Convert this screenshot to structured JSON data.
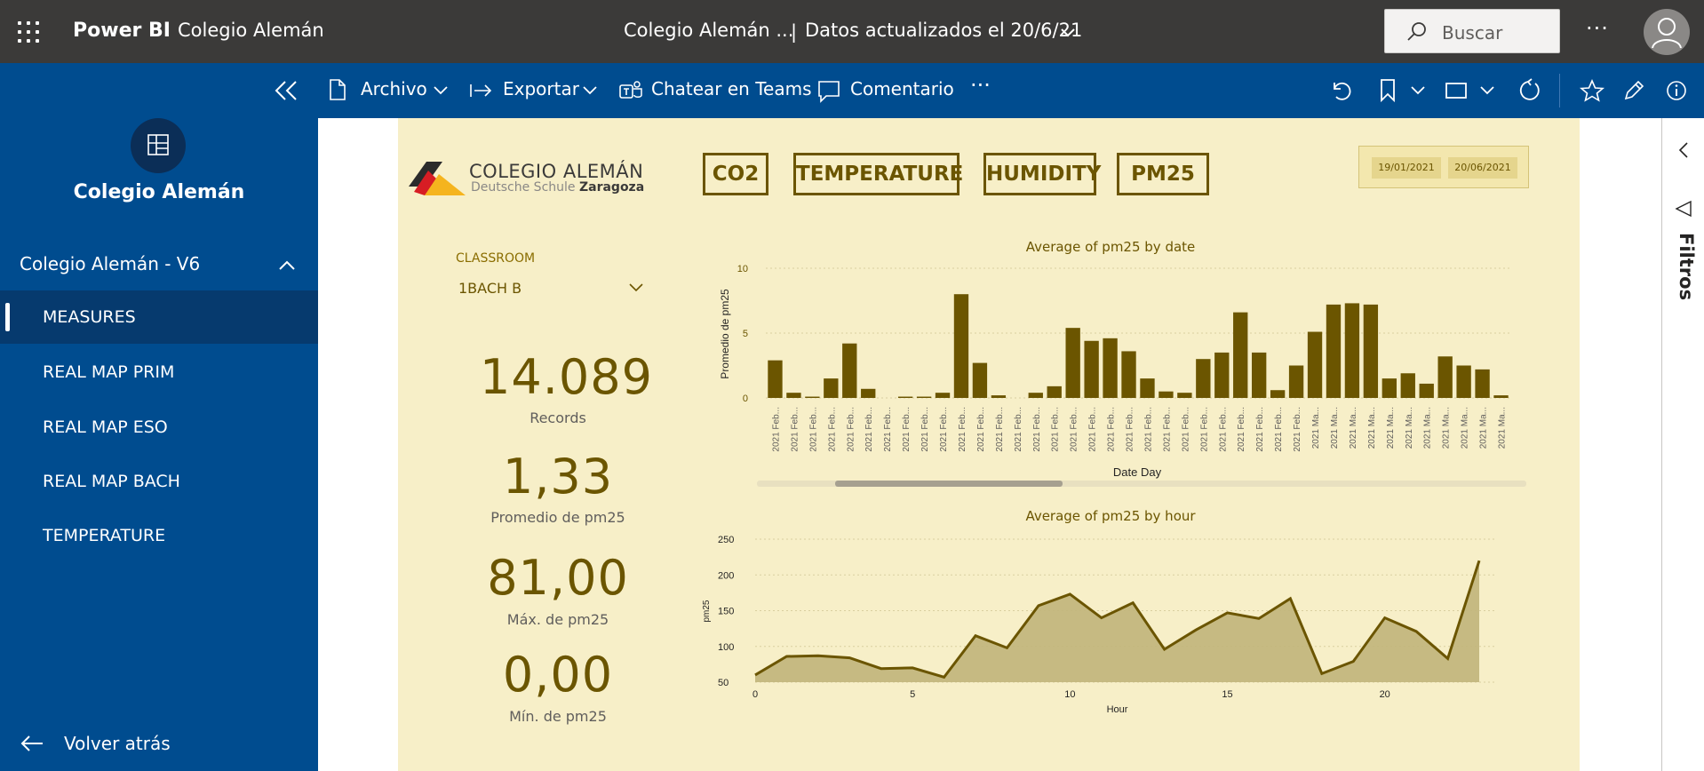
{
  "topbar": {
    "brand": "Power BI",
    "workspace": "Colegio Alemán",
    "report_title": "Colegio Alemán ...",
    "separator": "|",
    "updated": "Datos actualizados el 20/6/21",
    "search_placeholder": "Buscar",
    "more": "···"
  },
  "actionbar": {
    "archivo": "Archivo",
    "exportar": "Exportar",
    "teams": "Chatear en Teams",
    "comentario": "Comentario",
    "more": "···"
  },
  "sidebar": {
    "workspace_name": "Colegio Alemán",
    "report_name": "Colegio Alemán - V6",
    "pages": [
      "MEASURES",
      "REAL MAP PRIM",
      "REAL MAP ESO",
      "REAL MAP BACH",
      "TEMPERATURE"
    ],
    "back": "Volver atrás"
  },
  "report": {
    "logo_line1": "COLEGIO ALEMÁN",
    "logo_line2a": "Deutsche Schule ",
    "logo_line2b": "Zaragoza",
    "tabs": [
      "CO2",
      "TEMPERATURE",
      "HUMIDITY",
      "PM25"
    ],
    "date_from": "19/01/2021",
    "date_to": "20/06/2021",
    "classroom_label": "CLASSROOM",
    "classroom_value": "1BACH B",
    "kpis": [
      {
        "value": "14.089",
        "label": "Records"
      },
      {
        "value": "1,33",
        "label": "Promedio de pm25"
      },
      {
        "value": "81,00",
        "label": "Máx. de pm25"
      },
      {
        "value": "0,00",
        "label": "Mín. de pm25"
      }
    ],
    "filters_label": "Filtros",
    "colors": {
      "accent": "#6b5500",
      "background": "#f7efc8",
      "bar": "#6b5500",
      "area": "#c0b47a"
    }
  },
  "chart_data": [
    {
      "type": "bar",
      "title": "Average of pm25 by date",
      "xlabel": "Date Day",
      "ylabel": "Promedio de pm25",
      "ylim": [
        0,
        10
      ],
      "yticks": [
        0,
        5,
        10
      ],
      "categories": [
        "2021 Feb...",
        "2021 Feb...",
        "2021 Feb...",
        "2021 Feb...",
        "2021 Feb...",
        "2021 Feb...",
        "2021 Feb...",
        "2021 Feb...",
        "2021 Feb...",
        "2021 Feb...",
        "2021 Feb...",
        "2021 Feb...",
        "2021 Feb...",
        "2021 Feb...",
        "2021 Feb...",
        "2021 Feb...",
        "2021 Feb...",
        "2021 Feb...",
        "2021 Feb...",
        "2021 Feb...",
        "2021 Feb...",
        "2021 Feb...",
        "2021 Feb...",
        "2021 Feb...",
        "2021 Feb...",
        "2021 Feb...",
        "2021 Feb...",
        "2021 Feb...",
        "2021 Feb...",
        "2021 Ma...",
        "2021 Ma...",
        "2021 Ma...",
        "2021 Ma...",
        "2021 Ma...",
        "2021 Ma...",
        "2021 Ma...",
        "2021 Ma...",
        "2021 Ma...",
        "2021 Ma...",
        "2021 Ma..."
      ],
      "values": [
        2.9,
        0.4,
        0.1,
        1.5,
        4.2,
        0.7,
        0,
        0.1,
        0.1,
        0.4,
        8.0,
        2.7,
        0.2,
        0,
        0.4,
        0.9,
        5.4,
        4.4,
        4.6,
        3.6,
        1.5,
        0.5,
        0.4,
        3.0,
        3.5,
        6.6,
        3.5,
        0.6,
        2.5,
        5.1,
        7.2,
        7.3,
        7.2,
        1.5,
        1.9,
        1.1,
        3.2,
        2.5,
        2.2,
        0.2
      ],
      "grid": true
    },
    {
      "type": "area",
      "title": "Average of pm25 by hour",
      "xlabel": "Hour",
      "ylabel": "pm25",
      "xlim": [
        0,
        23
      ],
      "ylim": [
        50,
        250
      ],
      "xticks": [
        0,
        5,
        10,
        15,
        20
      ],
      "yticks": [
        50,
        100,
        150,
        200,
        250
      ],
      "x": [
        0,
        1,
        2,
        3,
        4,
        5,
        6,
        7,
        8,
        9,
        10,
        11,
        12,
        13,
        14,
        15,
        16,
        17,
        18,
        19,
        20,
        21,
        22,
        23
      ],
      "values": [
        60,
        86,
        87,
        84,
        69,
        70,
        57,
        115,
        98,
        157,
        173,
        140,
        161,
        96,
        123,
        147,
        139,
        167,
        62,
        79,
        140,
        121,
        83,
        220
      ],
      "grid": true
    }
  ]
}
